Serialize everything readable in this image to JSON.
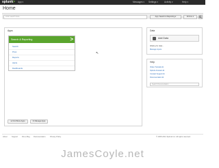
{
  "topbar": {
    "logo_prefix": "splunk",
    "logo_suffix": ">",
    "app_menu": "App ▾",
    "messages": "Messages ▾",
    "settings": "Settings ▾",
    "activity": "Activity ▾",
    "help": "Help ▾"
  },
  "page": {
    "title": "Home"
  },
  "search": {
    "placeholder": "enter search here...",
    "app_selector": "App: Search & Reporting ▾",
    "time_range": "All time ▾",
    "go_icon": "search-icon"
  },
  "apps": {
    "heading": "Apps",
    "card": {
      "title": "Search & Reporting",
      "items": [
        "Search",
        "Pivot",
        "Reports",
        "Alerts",
        "Dashboards"
      ]
    },
    "buttons": {
      "browse": "⊕ Find More Apps",
      "manage": "⚙ Manage Apps"
    }
  },
  "data_panel": {
    "heading": "Data",
    "add_data": "Add Data",
    "waiting_text": "Waiting for data...",
    "manage_inputs": "Manage inputs"
  },
  "help_panel": {
    "heading": "Help",
    "links": [
      "Video Tutorials ⧉",
      "Splunk Answers ⧉",
      "Contact Support ⧉",
      "Documentation ⧉"
    ],
    "search_placeholder": "Search Documentation"
  },
  "footer": {
    "links": [
      "About",
      "Support",
      "File a Bug",
      "Documentation",
      "Privacy Policy"
    ],
    "copyright": "© 2005-2014 Splunk Inc. All rights reserved."
  },
  "watermark": "JamesCoyle.net",
  "colors": {
    "accent": "#5aa52d",
    "topbar": "#2b2b2b",
    "link": "#2a6ebb"
  }
}
